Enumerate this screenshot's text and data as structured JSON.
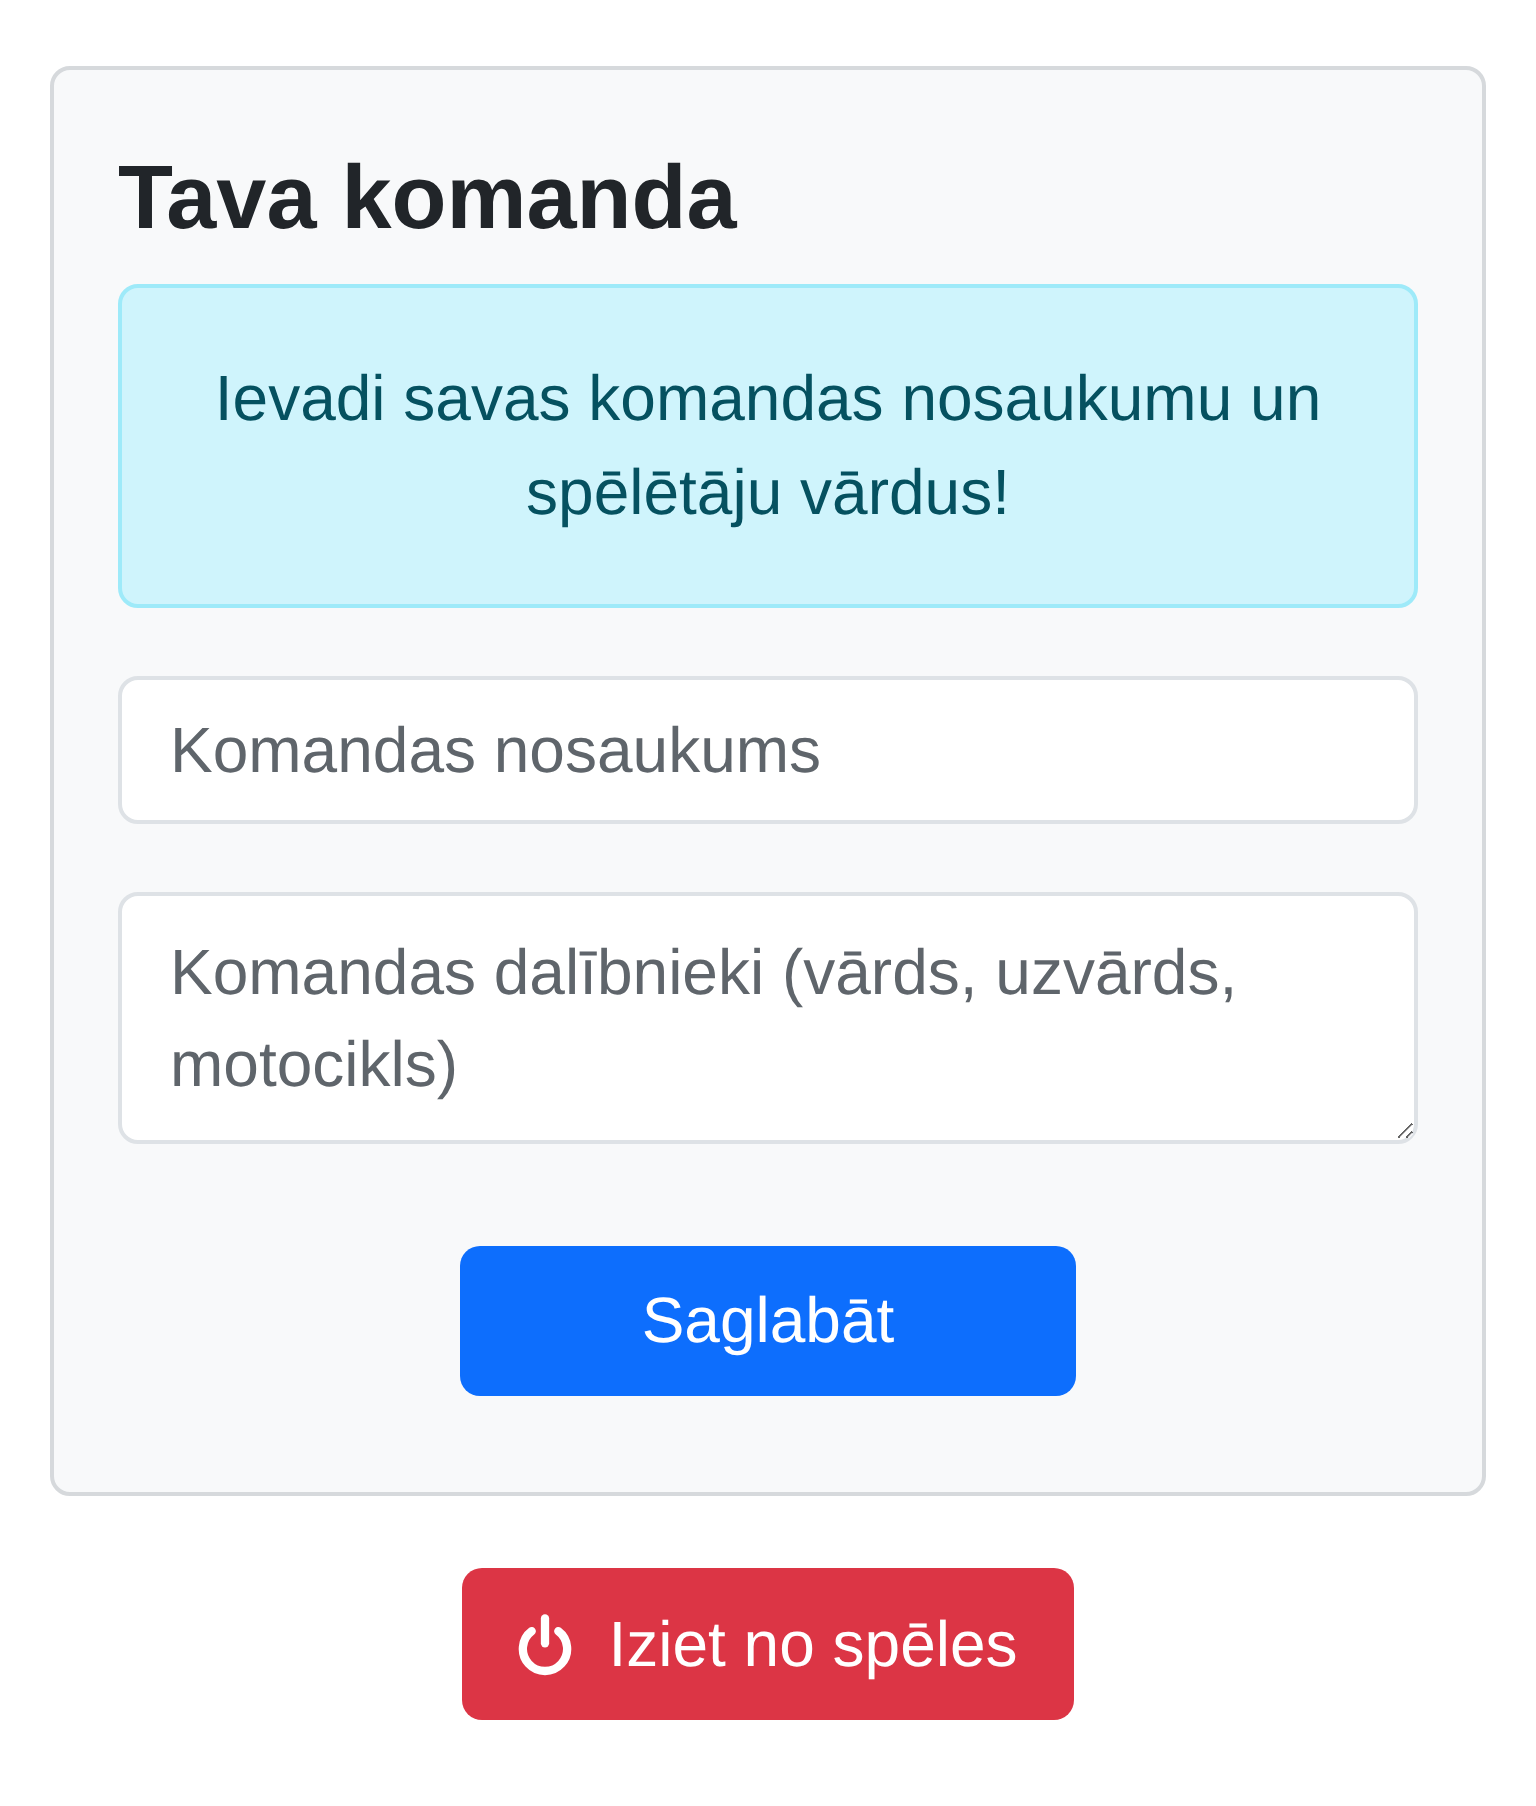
{
  "card": {
    "title": "Tava komanda",
    "alert": "Ievadi savas komandas nosaukumu un spēlētāju vārdus!",
    "fields": [
      {
        "kind": "input",
        "placeholder": "Komandas nosaukums"
      },
      {
        "kind": "textarea",
        "placeholder": "Komandas dalībnieki (vārds, uzvārds, motocikls)"
      }
    ],
    "save_button": {
      "label": "Saglabāt"
    }
  },
  "exit_button": {
    "label": "Iziet no spēles"
  }
}
